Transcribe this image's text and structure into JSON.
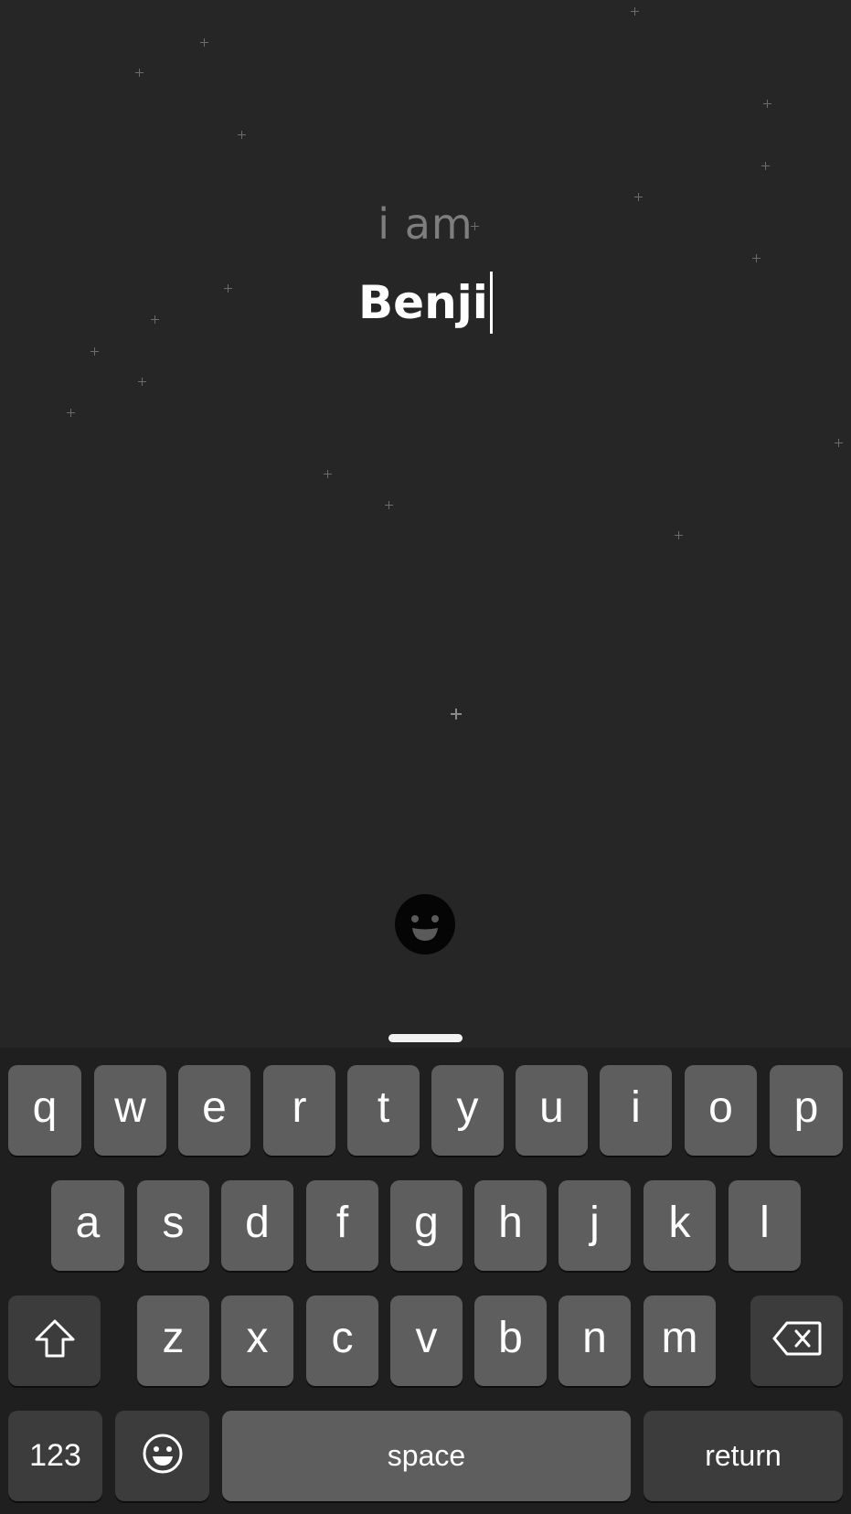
{
  "onboarding": {
    "prompt": "i am",
    "name_value": "Benji"
  },
  "icons": {
    "avatar": "smiley-face-avatar-icon",
    "shift": "shift-arrow-icon",
    "delete": "backspace-icon",
    "emoji": "emoji-face-icon"
  },
  "keyboard": {
    "row1": [
      "q",
      "w",
      "e",
      "r",
      "t",
      "y",
      "u",
      "i",
      "o",
      "p"
    ],
    "row2": [
      "a",
      "s",
      "d",
      "f",
      "g",
      "h",
      "j",
      "k",
      "l"
    ],
    "row3": [
      "z",
      "x",
      "c",
      "v",
      "b",
      "n",
      "m"
    ],
    "numbers_label": "123",
    "space_label": "space",
    "return_label": "return"
  },
  "colors": {
    "background": "#262626",
    "keyboard_bg": "#1f1f1f",
    "key": "#5e5e5e",
    "key_dark": "#3c3c3c",
    "text": "#ffffff",
    "prompt_text": "#8e8e8e"
  }
}
